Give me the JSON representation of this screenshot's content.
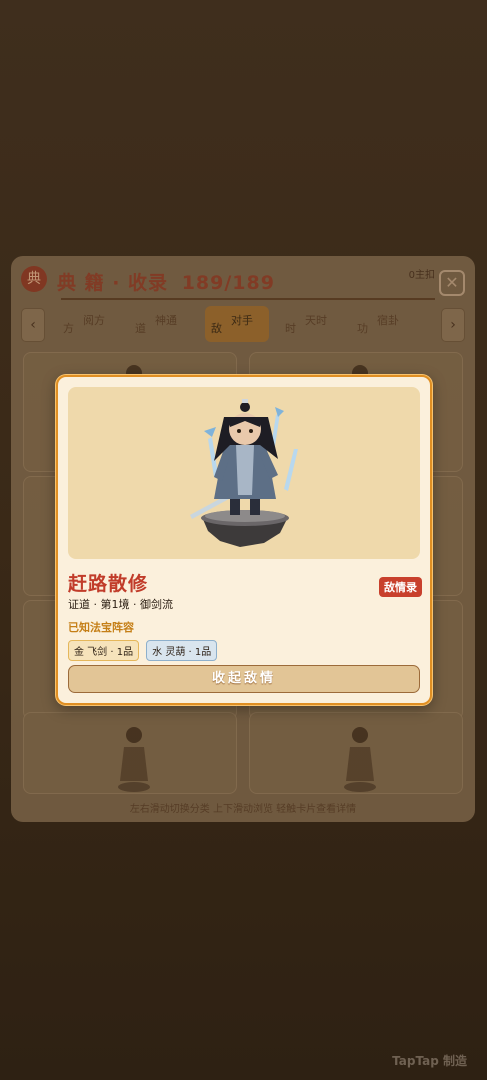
{
  "codex": {
    "logo": "典",
    "title": "典 籍 · 收录",
    "count": "189/189",
    "master": "0主扣",
    "close": "✕",
    "tabs": [
      {
        "glyph": "方",
        "label": "阅方"
      },
      {
        "glyph": "道",
        "label": "神通"
      },
      {
        "glyph": "敌",
        "label": "对手"
      },
      {
        "glyph": "时",
        "label": "天时"
      },
      {
        "glyph": "功",
        "label": "宿卦"
      }
    ],
    "arrow_left": "‹",
    "arrow_right": "›",
    "hint": "左右滑动切换分类    上下滑动浏览    轻触卡片查看详情"
  },
  "modal": {
    "enemy_name": "赶路散修",
    "intel_badge": "敌情录",
    "meta": "证道 · 第1境 · 御剑流",
    "formation_label": "已知法宝阵容",
    "treasures": [
      {
        "text": "金 飞剑 · 1品"
      },
      {
        "text": "水 灵葫 · 1品"
      }
    ],
    "collapse_button": "收起敌情"
  },
  "watermark": "TapTap 制造",
  "colors": {
    "accent_orange": "#e08f23",
    "enemy_red": "#c13c2a",
    "badge_red": "#c8402c",
    "gold_text": "#c57f17"
  }
}
